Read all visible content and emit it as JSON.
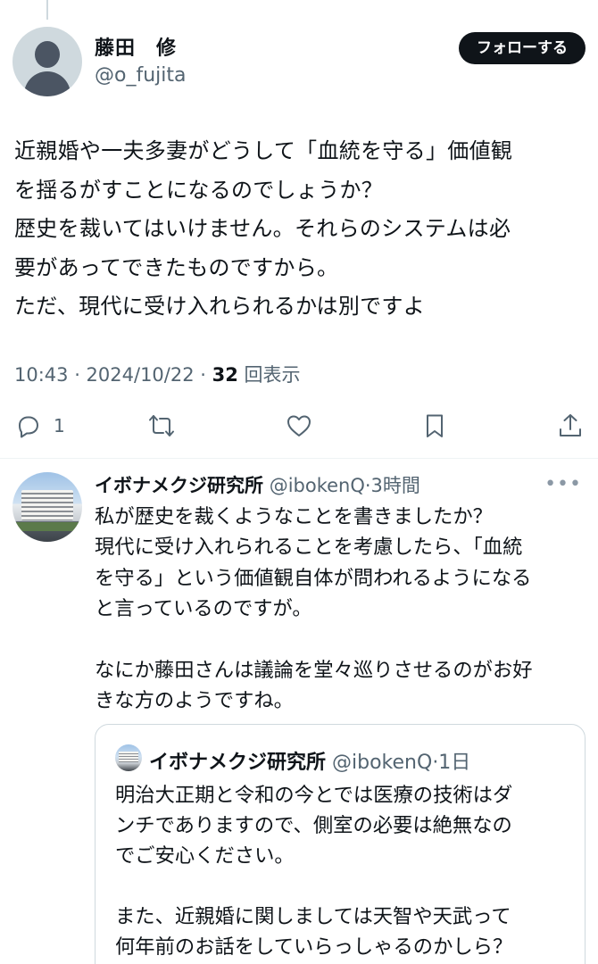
{
  "main_tweet": {
    "author_name": "藤田　修",
    "author_handle": "@o_fujita",
    "follow_label": "フォローする",
    "text": "近親婚や一夫多妻がどうして「血統を守る」価値観\nを揺るがすことになるのでしょうか？\n歴史を裁いてはいけません。それらのシステムは必\n要があってできたものですから。\nただ、現代に受け入れられるかは別ですよ",
    "time": "10:43 · 2024/10/22 · ",
    "views_count": "32",
    "views_label": " 回表示"
  },
  "actions": {
    "reply_count": "1",
    "icons": [
      "reply-icon",
      "retweet-icon",
      "like-icon",
      "bookmark-icon",
      "share-icon"
    ]
  },
  "reply": {
    "author_name": "イボナメクジ研究所",
    "author_handle": "@ibokenQ",
    "time": "·3時間",
    "more_label": "•••",
    "text": "私が歴史を裁くようなことを書きましたか？\n現代に受け入れられることを考慮したら、「血統\nを守る」という価値観自体が問われるようになる\nと言っているのですが。\n\nなにか藤田さんは議論を堂々巡りさせるのがお好\nきな方のようですね。"
  },
  "quoted_tweet": {
    "author_name": "イボナメクジ研究所",
    "author_handle": "@ibokenQ",
    "time": "·1日",
    "text": "明治大正期と令和の今とでは医療の技術はダ\nンチでありますので、側室の必要は絶無なの\nでご安心ください。\n\nまた、近親婚に関しましては天智や天武って\n何年前のお話をしていらっしゃるのかしら？"
  },
  "colors": {
    "text": "#0f1419",
    "secondary": "#536471",
    "border": "#cfd9de",
    "follow_bg": "#0f1419"
  }
}
